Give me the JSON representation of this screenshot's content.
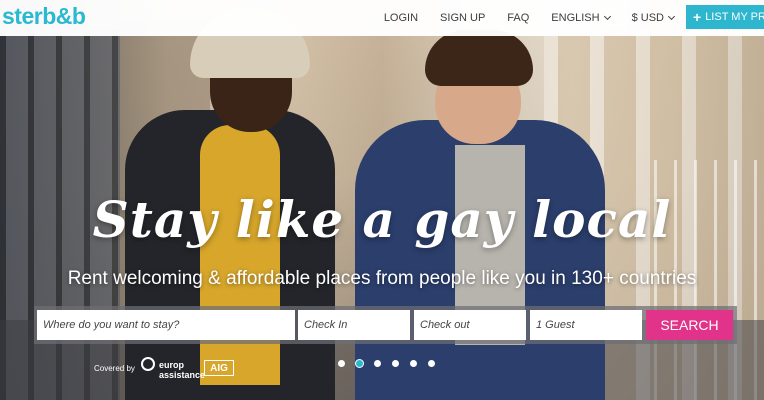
{
  "nav": {
    "logo": "sterb&b",
    "links": [
      "LOGIN",
      "SIGN UP",
      "FAQ"
    ],
    "language": "ENGLISH",
    "currency": "$ USD",
    "list_button": "LIST MY PRO"
  },
  "hero": {
    "headline": "Stay like a gay local",
    "subheadline": "Rent welcoming & affordable places from people like you in 130+ countries"
  },
  "search": {
    "where_placeholder": "Where do you want to stay?",
    "checkin_placeholder": "Check In",
    "checkout_placeholder": "Check out",
    "guests": "1 Guest",
    "button": "SEARCH"
  },
  "insurance": {
    "covered_by": "Covered by",
    "partner1": "europ assistance",
    "partner2": "AIG"
  },
  "slider": {
    "count": 6,
    "active_index": 1
  },
  "colors": {
    "brand": "#29b9d1",
    "search_button": "#e03389"
  }
}
